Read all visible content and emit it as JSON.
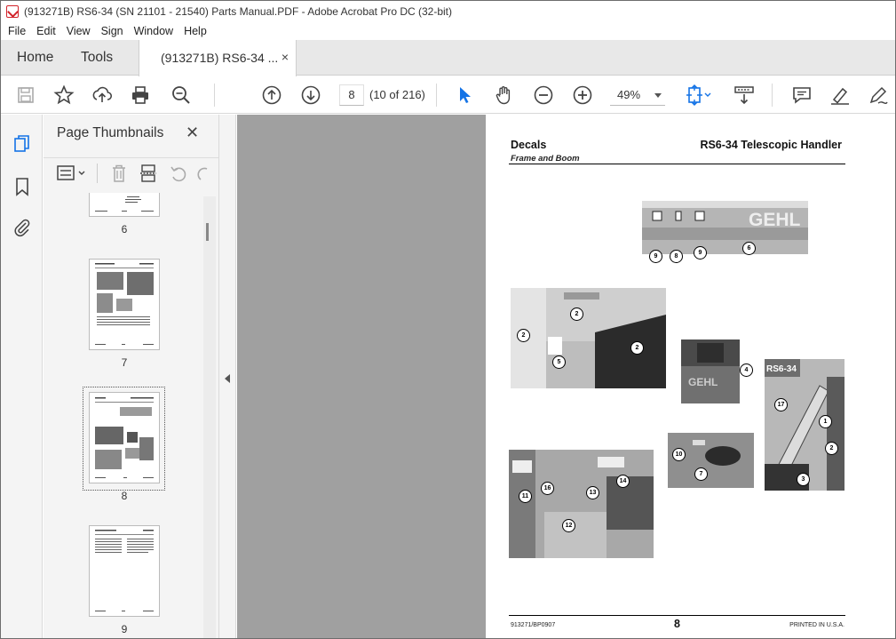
{
  "window": {
    "title": "(913271B) RS6-34 (SN 21101 - 21540) Parts Manual.PDF - Adobe Acrobat Pro DC (32-bit)"
  },
  "menu": {
    "items": [
      "File",
      "Edit",
      "View",
      "Sign",
      "Window",
      "Help"
    ]
  },
  "tabs": {
    "home": "Home",
    "tools": "Tools",
    "document": "(913271B) RS6-34 ...",
    "close_glyph": "×"
  },
  "toolbar": {
    "page_number": "8",
    "page_count": "(10 of 216)",
    "zoom": "49%",
    "icons": [
      "save-icon",
      "star-icon",
      "upload-icon",
      "print-icon",
      "search-zoom-icon",
      "page-up-icon",
      "page-down-icon",
      "select-arrow-icon",
      "hand-icon",
      "zoom-out-icon",
      "zoom-in-icon",
      "fit-page-icon",
      "scroll-mode-icon",
      "comment-icon",
      "highlight-icon",
      "sign-icon"
    ]
  },
  "thumbnails_panel": {
    "title": "Page Thumbnails",
    "close_glyph": "✕",
    "pages": [
      {
        "label": "6"
      },
      {
        "label": "7"
      },
      {
        "label": "8",
        "selected": true
      },
      {
        "label": "9"
      }
    ]
  },
  "document": {
    "header_title": "Decals",
    "header_subtitle": "Frame and Boom",
    "header_model": "RS6-34 Telescopic Handler",
    "footer_left": "913271/BP0907",
    "footer_page": "8",
    "footer_right": "PRINTED IN U.S.A.",
    "brand_text": "GEHL",
    "boom_label": "RS6-34",
    "callouts": {
      "boom": [
        "9",
        "8",
        "9",
        "6"
      ],
      "cab_left": [
        "2",
        "2",
        "5",
        "2"
      ],
      "console": [
        "4"
      ],
      "boom_side": [
        "17",
        "1",
        "2",
        "3"
      ],
      "floor": [
        "11",
        "16",
        "13",
        "14",
        "12"
      ],
      "tank": [
        "10",
        "7"
      ]
    }
  },
  "colors": {
    "accent_red": "#d2232a",
    "icon_blue": "#1473e6",
    "canvas_gray": "#a0a0a0",
    "panel_bg": "#f4f4f4"
  }
}
